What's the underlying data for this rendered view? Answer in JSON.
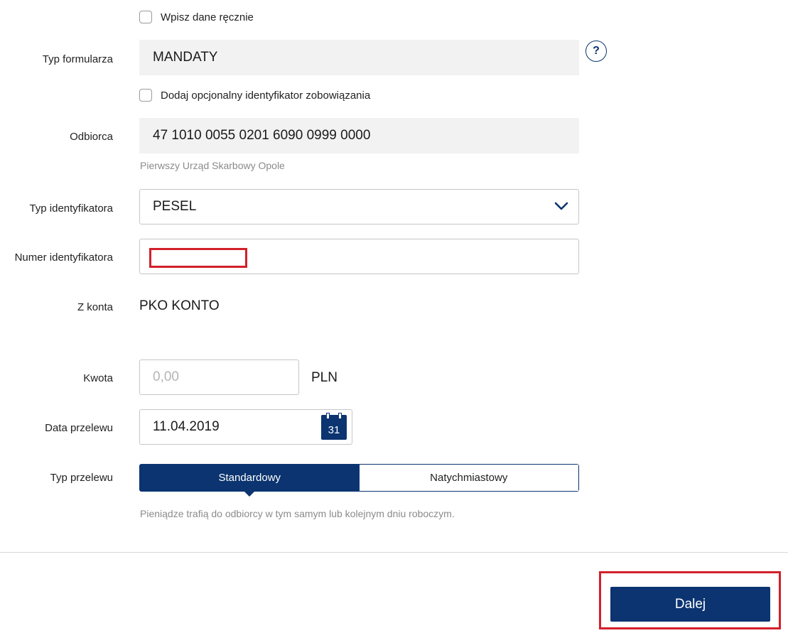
{
  "form": {
    "manual_entry": {
      "label": "Wpisz dane ręcznie",
      "checked": false
    },
    "form_type": {
      "label": "Typ formularza",
      "value": "MANDATY",
      "help_symbol": "?"
    },
    "optional_id": {
      "label": "Dodaj opcjonalny identyfikator zobowiązania",
      "checked": false
    },
    "recipient": {
      "label": "Odbiorca",
      "account": "47 1010 0055 0201 6090 0999 0000",
      "name": "Pierwszy Urząd Skarbowy Opole"
    },
    "id_type": {
      "label": "Typ identyfikatora",
      "value": "PESEL"
    },
    "id_number": {
      "label": "Numer identyfikatora",
      "value": ""
    },
    "from_account": {
      "label": "Z konta",
      "value": "PKO KONTO"
    },
    "amount": {
      "label": "Kwota",
      "placeholder": "0,00",
      "currency": "PLN"
    },
    "transfer_date": {
      "label": "Data przelewu",
      "value": "11.04.2019",
      "calendar_day": "31"
    },
    "transfer_type": {
      "label": "Typ przelewu",
      "options": [
        "Standardowy",
        "Natychmiastowy"
      ],
      "selected": "Standardowy",
      "hint": "Pieniądze trafią do odbiorcy w tym samym lub kolejnym dniu roboczym."
    }
  },
  "actions": {
    "next_label": "Dalej"
  },
  "colors": {
    "primary": "#0b3470",
    "highlight": "#d2202a",
    "readonly_bg": "#f2f2f2",
    "hint": "#8b8b8b"
  }
}
